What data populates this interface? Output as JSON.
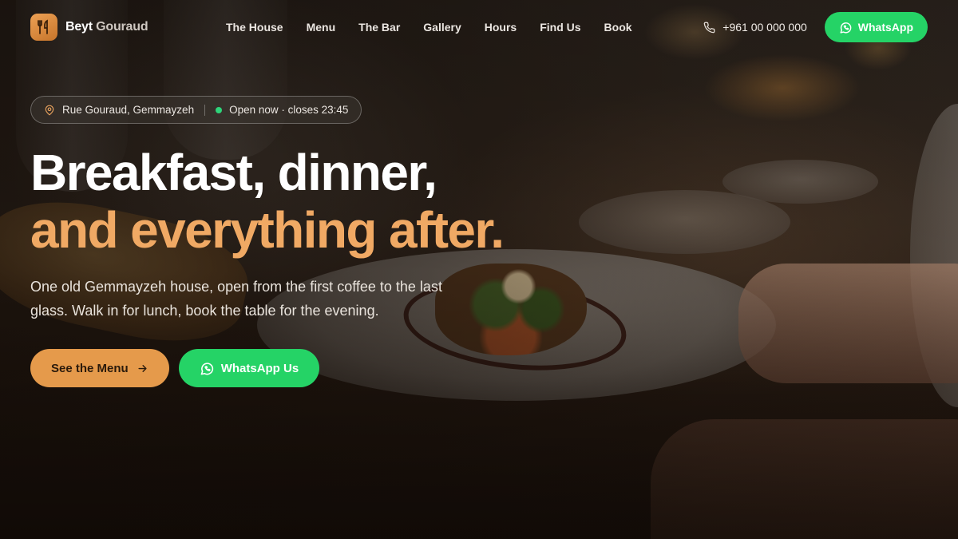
{
  "brand": {
    "name_part1": "Beyt",
    "name_part2": "Gouraud",
    "logo_icon": "fork-knife-icon"
  },
  "nav": {
    "links": [
      "The House",
      "Menu",
      "The Bar",
      "Gallery",
      "Hours",
      "Find Us",
      "Book"
    ],
    "phone": "+961 00 000 000",
    "phone_icon": "phone-icon",
    "whatsapp_label": "WhatsApp",
    "whatsapp_icon": "whatsapp-icon"
  },
  "hero": {
    "location": "Rue Gouraud, Gemmayzeh",
    "location_icon": "map-pin-icon",
    "status": "Open now · closes 23:45",
    "headline_line1": "Breakfast, dinner,",
    "headline_line2": "and everything after.",
    "subtitle": "One old Gemmayzeh house, open from the first coffee to the last glass. Walk in for lunch, book the table for the evening.",
    "cta_menu_label": "See the Menu",
    "cta_menu_icon": "arrow-right-icon",
    "cta_whatsapp_label": "WhatsApp Us",
    "cta_whatsapp_icon": "whatsapp-icon"
  },
  "colors": {
    "accent": "#f0a964",
    "button_accent": "#e59a4b",
    "whatsapp_green": "#25d366",
    "open_dot": "#2ed47a"
  }
}
